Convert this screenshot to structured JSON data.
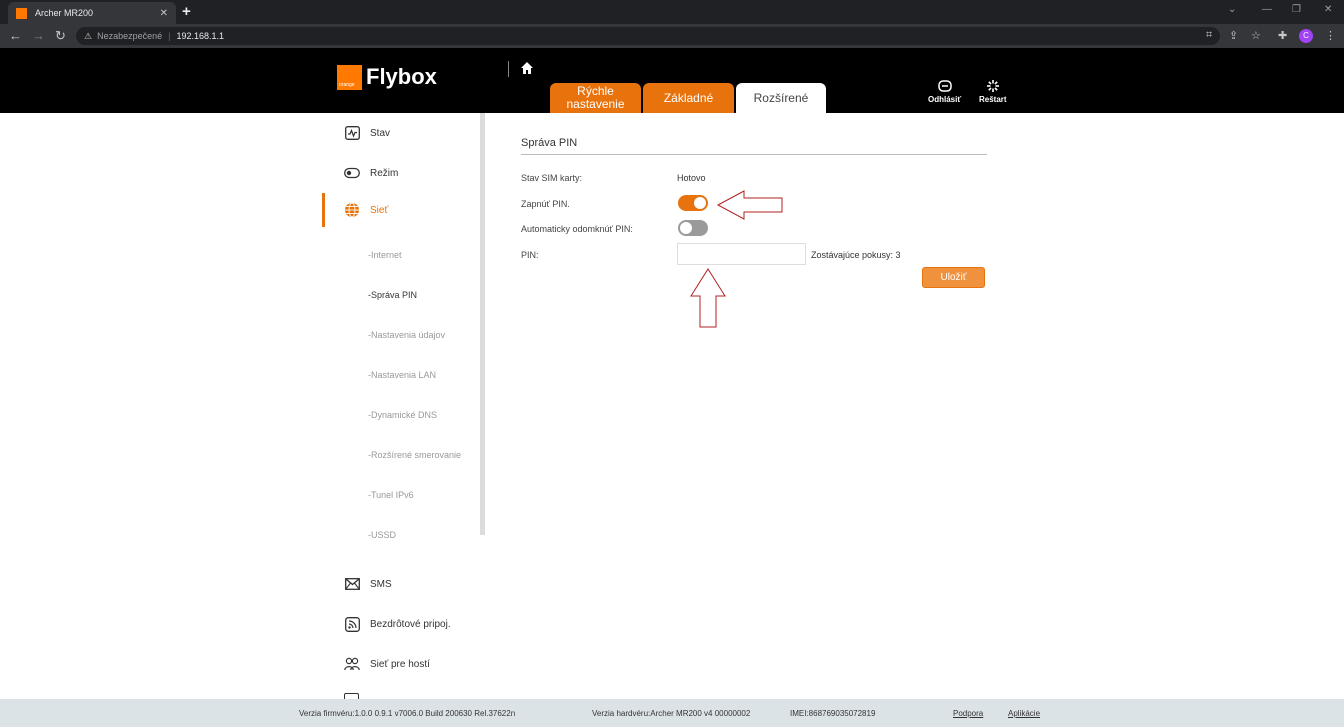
{
  "browser": {
    "tab_title": "Archer MR200",
    "tab_close": "✕",
    "new_tab": "+",
    "security_label": "Nezabezpečené",
    "url": "192.168.1.1",
    "profile_initial": "C"
  },
  "header": {
    "logo_small": "orange",
    "logo_text": "Flybox",
    "tabs": [
      "Rýchle nastavenie",
      "Základné",
      "Rozšírené"
    ],
    "logout_label": "Odhlásiť",
    "restart_label": "Reštart"
  },
  "sidebar": {
    "main_items": [
      "Stav",
      "Režim",
      "Sieť"
    ],
    "sub_items": [
      "-Internet",
      "-Správa PIN",
      "-Nastavenia údajov",
      "-Nastavenia LAN",
      "-Dynamické DNS",
      "-Rozšírené smerovanie",
      "-Tunel IPv6",
      "-USSD"
    ],
    "bottom_items": [
      "SMS",
      "Bezdrôtové pripoj.",
      "Sieť pre hostí"
    ]
  },
  "content": {
    "section_title": "Správa PIN",
    "sim_status_label": "Stav SIM karty:",
    "sim_status_value": "Hotovo",
    "enable_pin_label": "Zapnúť PIN.",
    "enable_pin_on": true,
    "auto_unlock_label": "Automaticky odomknúť PIN:",
    "auto_unlock_on": false,
    "pin_label": "PIN:",
    "pin_value": "",
    "remaining_attempts": "Zostávajúce pokusy: 3",
    "save_label": "Uložiť"
  },
  "footer": {
    "firmware": "Verzia firmvéru:1.0.0 0.9.1 v7006.0 Build 200630 Rel.37622n",
    "hardware": "Verzia hardvéru:Archer MR200 v4 00000002",
    "imei": "IMEI:868769035072819",
    "support": "Podpora",
    "apps": "Aplikácie"
  },
  "colors": {
    "accent": "#e8730c",
    "header_bg": "#000000",
    "annotation_arrow": "#b22222"
  }
}
